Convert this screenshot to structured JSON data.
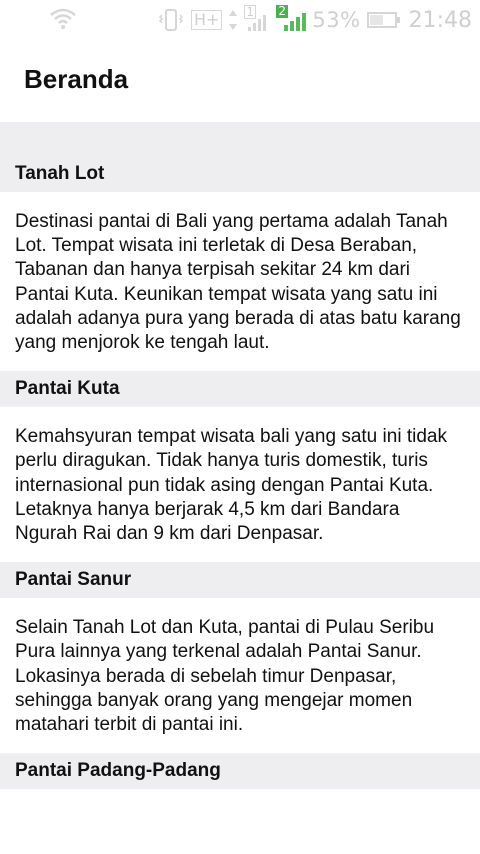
{
  "status_bar": {
    "network_type": "H+",
    "sim1_label": "1",
    "sim2_label": "2",
    "battery_percent": "53%",
    "time": "21:48"
  },
  "app_bar": {
    "title": "Beranda"
  },
  "sections": [
    {
      "title": "Tanah Lot",
      "body": "Destinasi pantai di Bali yang pertama adalah Tanah Lot. Tempat wisata ini terletak di Desa Beraban, Tabanan dan hanya terpisah sekitar 24 km dari Pantai Kuta. Keunikan tempat wisata yang satu ini adalah adanya pura yang berada di atas batu karang yang menjorok ke tengah laut."
    },
    {
      "title": "Pantai Kuta",
      "body": "Kemahsyuran tempat wisata bali yang satu ini tidak perlu diragukan. Tidak hanya turis domestik, turis internasional pun tidak asing dengan Pantai Kuta. Letaknya hanya berjarak 4,5 km dari Bandara Ngurah Rai dan 9 km dari Denpasar."
    },
    {
      "title": "Pantai Sanur",
      "body": "Selain Tanah Lot dan Kuta, pantai di Pulau Seribu Pura lainnya yang terkenal adalah Pantai Sanur. Lokasinya berada di sebelah timur Denpasar, sehingga banyak orang yang mengejar momen matahari terbit di pantai ini."
    },
    {
      "title": "Pantai Padang-Padang",
      "body": ""
    }
  ]
}
